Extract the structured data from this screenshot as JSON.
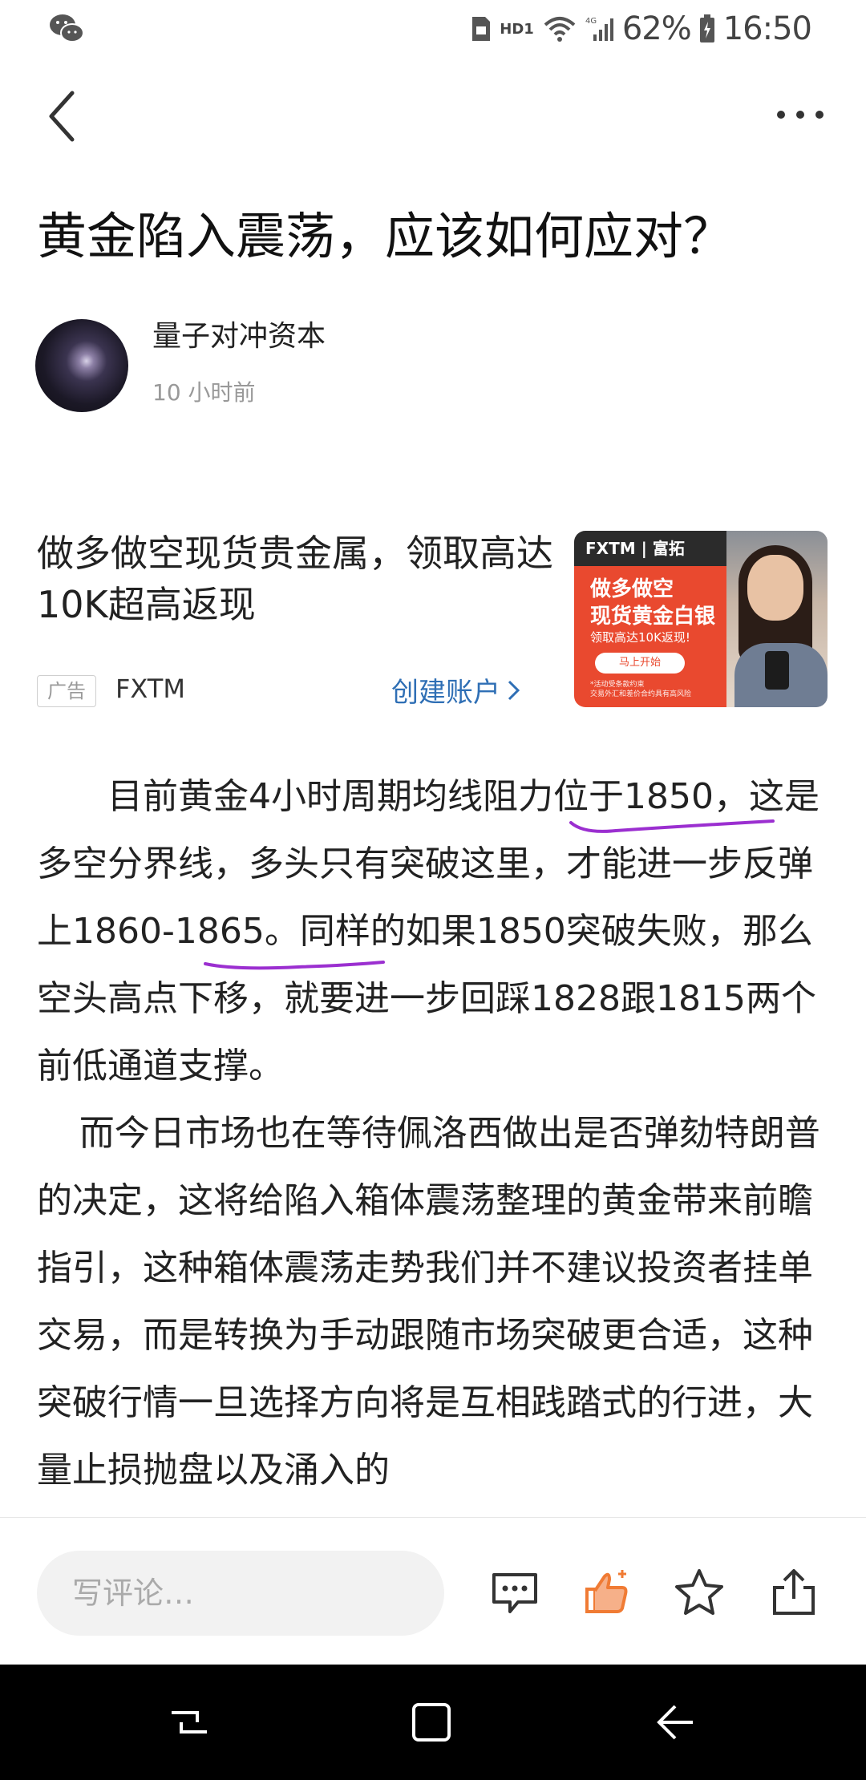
{
  "status_bar": {
    "hd_label": "HD1",
    "network": "4G",
    "battery": "62%",
    "time": "16:50"
  },
  "article": {
    "title": "黄金陷入震荡，应该如何应对？",
    "author": "量子对冲资本",
    "time_ago": "10 小时前",
    "paragraph1": "目前黄金4小时周期均线阻力位于1850，这是多空分界线，多头只有突破这里，才能进一步反弹上1860-1865。同样的如果1850突破失败，那么空头高点下移，就要进一步回踩1828跟1815两个前低通道支撑。",
    "paragraph2": "而今日市场也在等待佩洛西做出是否弹劾特朗普的决定，这将给陷入箱体震荡整理的黄金带来前瞻指引，这种箱体震荡走势我们并不建议投资者挂单交易，而是转换为手动跟随市场突破更合适，这种突破行情一旦选择方向将是互相践踏式的行进，大量止损抛盘以及涌入的"
  },
  "ad": {
    "headline": "做多做空现货贵金属，领取高达10K超高返现",
    "tag": "广告",
    "brand": "FXTM",
    "cta": "创建账户",
    "image_header": "FXTM | 富拓",
    "image_line1": "做多做空",
    "image_line2": "现货黄金白银",
    "image_sub": "领取高达10K返现!",
    "image_button": "马上开始",
    "image_fine1": "*活动受条款约束",
    "image_fine2": "交易外汇和差价合约具有高风险"
  },
  "toolbar": {
    "comment_placeholder": "写评论…",
    "icons": [
      "comment-icon",
      "like-icon",
      "star-icon",
      "share-icon"
    ],
    "like_color": "#f07b34"
  },
  "underline_color": "#9b2fd0"
}
